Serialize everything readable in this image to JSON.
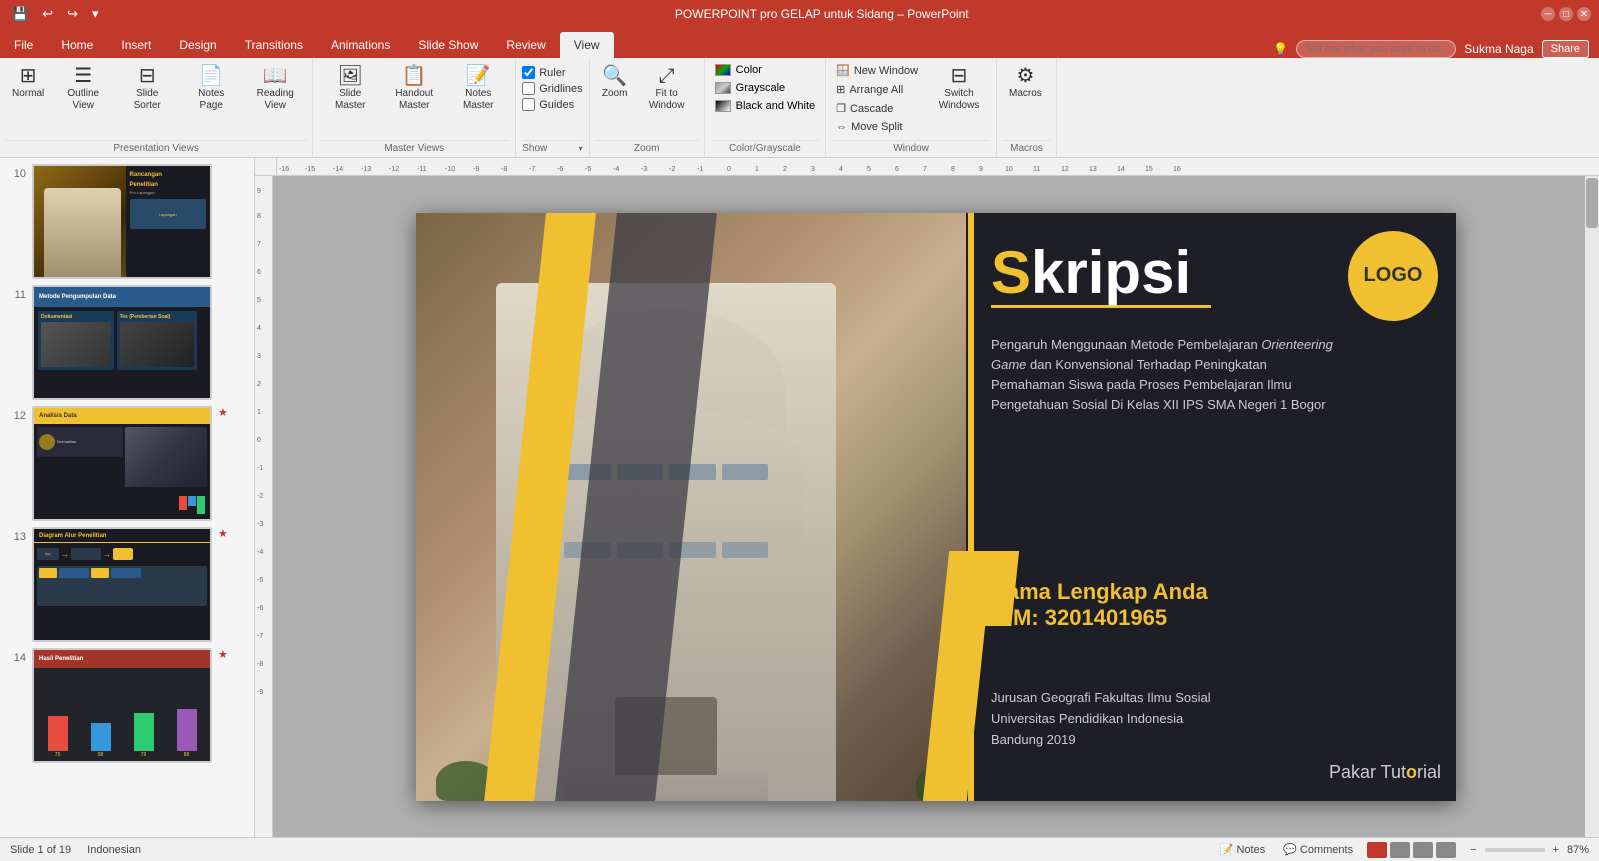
{
  "titlebar": {
    "title": "POWERPOINT pro GELAP untuk Sidang – PowerPoint",
    "quickaccess": [
      "save",
      "undo",
      "redo",
      "customize"
    ]
  },
  "ribbontabs": {
    "tabs": [
      "File",
      "Home",
      "Insert",
      "Design",
      "Transitions",
      "Animations",
      "Slide Show",
      "Review",
      "View"
    ],
    "active": "View",
    "tell_me": "Tell me what you want to do...",
    "user": "Sukma Naga",
    "share": "Share"
  },
  "ribbon": {
    "groups": {
      "presentation_views": {
        "label": "Presentation Views",
        "buttons": [
          "Normal",
          "Outline View",
          "Slide Sorter",
          "Notes Page",
          "Reading View"
        ]
      },
      "master_views": {
        "label": "Master Views",
        "buttons": [
          "Slide Master",
          "Handout Master",
          "Notes Master"
        ]
      },
      "show": {
        "label": "Show",
        "checkboxes": [
          "Ruler",
          "Gridlines",
          "Guides"
        ],
        "more": "▾"
      },
      "zoom": {
        "label": "Zoom",
        "buttons": [
          "Zoom",
          "Fit to Window"
        ]
      },
      "color_grayscale": {
        "label": "Color/Grayscale",
        "items": [
          "Color",
          "Grayscale",
          "Black and White"
        ],
        "active": "Color"
      },
      "window": {
        "label": "Window",
        "buttons": [
          "New Window",
          "Arrange All",
          "Cascade",
          "Move Split",
          "Switch Windows"
        ]
      },
      "macros": {
        "label": "Macros",
        "buttons": [
          "Macros"
        ]
      }
    }
  },
  "slides": [
    {
      "num": "10",
      "type": "rancangan",
      "title": "Rancangan Penelitian",
      "star": false
    },
    {
      "num": "11",
      "type": "metode",
      "title": "Metode Pengumpulan Data",
      "star": false
    },
    {
      "num": "12",
      "type": "analisis",
      "title": "Analisis Data",
      "star": true
    },
    {
      "num": "13",
      "type": "diagram",
      "title": "Diagram Alur Penelitian",
      "star": true
    },
    {
      "num": "14",
      "type": "hasil",
      "title": "Hasil Penelitian",
      "star": true
    }
  ],
  "main_slide": {
    "logo_text": "LOGO",
    "title_s": "S",
    "title_rest": "kripsi",
    "subtitle": "Pengaruh Menggunaan Metode Pembelajaran Orienteering Game dan Konvensional Terhadap Peningkatan Pemahaman Siswa pada Proses Pembelajaran Ilmu Pengetahuan Sosial Di Kelas XII IPS SMA Negeri 1 Bogor",
    "subtitle_italic": "Orienteering Game",
    "name": "Nama Lengkap Anda",
    "nim_label": "NIM: 3201401965",
    "institution_line1": "Jurusan Geografi  Fakultas Ilmu Sosial",
    "institution_line2": "Universitas Pendidikan Indonesia",
    "institution_line3": "Bandung 2019",
    "brand_normal": "Pakar Tut",
    "brand_highlight": "o",
    "brand_end": "rial"
  },
  "statusbar": {
    "slide_info": "Slide 1 of 19",
    "language": "Indonesian",
    "notes_label": "Notes",
    "comments_label": "Comments",
    "zoom_level": "87%"
  }
}
